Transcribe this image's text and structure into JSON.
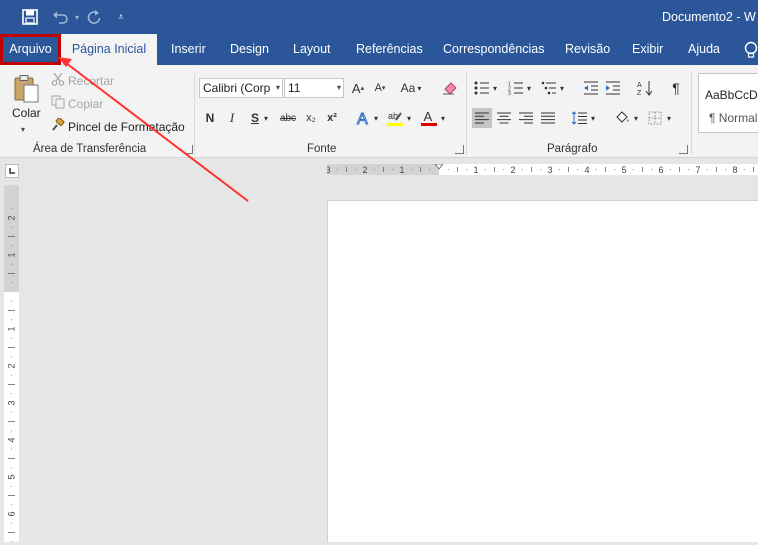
{
  "window": {
    "doc_title": "Documento2  -  W"
  },
  "quick_access": {
    "save_icon": "save-icon",
    "undo_icon": "undo-icon",
    "redo_icon": "redo-icon",
    "customize_icon": "customize-quick-access-icon"
  },
  "tabs": {
    "file": "Arquivo",
    "home": "Página Inicial",
    "insert": "Inserir",
    "design": "Design",
    "layout": "Layout",
    "references": "Referências",
    "mailings": "Correspondências",
    "review": "Revisão",
    "view": "Exibir",
    "help": "Ajuda",
    "tell_me_icon": "lightbulb-icon"
  },
  "clipboard": {
    "paste": "Colar",
    "cut": "Recortar",
    "copy": "Copiar",
    "format_painter": "Pincel de Formatação",
    "group_label": "Área de Transferência"
  },
  "font": {
    "font_name": "Calibri (Corp",
    "font_size": "11",
    "grow": "A",
    "shrink": "A",
    "case": "Aa",
    "bold": "N",
    "italic": "I",
    "underline": "S",
    "strike": "abc",
    "subscript": "x₂",
    "superscript": "x²",
    "font_color_letter": "A",
    "group_label": "Fonte",
    "colors": {
      "highlight": "#ffff00",
      "font_color": "#e00000"
    }
  },
  "paragraph": {
    "group_label": "Parágrafo",
    "pilcrow": "¶"
  },
  "styles": {
    "sample": "AaBbCcD",
    "normal": "¶ Normal"
  },
  "rulers": {
    "horizontal_ticks": [
      "3",
      "2",
      "1",
      "1",
      "2",
      "3",
      "4",
      "5",
      "6",
      "7",
      "8"
    ],
    "vertical_ticks": [
      "2",
      "1",
      "1",
      "2",
      "3",
      "4",
      "5",
      "6"
    ]
  },
  "colors": {
    "accent": "#2b579a",
    "highlight_box": "#c00000",
    "arrow": "#ff3030"
  }
}
